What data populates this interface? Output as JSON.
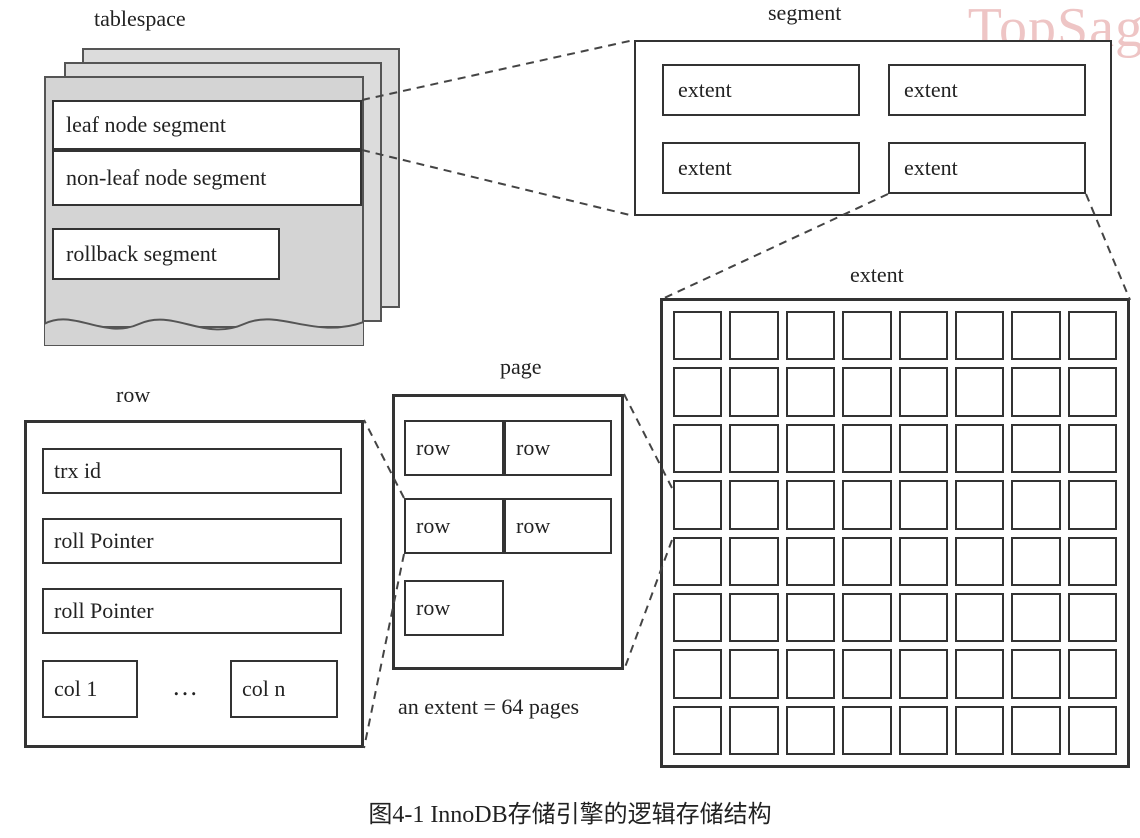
{
  "watermark": "TopSag",
  "labels": {
    "tablespace": "tablespace",
    "segment": "segment",
    "extent": "extent",
    "page": "page",
    "row": "row",
    "extent_note": "an extent = 64 pages"
  },
  "tablespace": {
    "seg1": "leaf node segment",
    "seg2": "non-leaf node segment",
    "seg3": "rollback segment"
  },
  "segment_panel": {
    "cells": [
      "extent",
      "extent",
      "extent",
      "extent"
    ]
  },
  "page_panel": {
    "cells": [
      "row",
      "row",
      "row",
      "row",
      "row"
    ]
  },
  "row_panel": {
    "r1": "trx id",
    "r2": "roll Pointer",
    "r3": "roll Pointer",
    "c1": "col  1",
    "dots": "…",
    "cn": "col  n"
  },
  "caption": "图4-1  InnoDB存储引擎的逻辑存储结构",
  "extent_grid": {
    "rows": 8,
    "cols": 8
  }
}
